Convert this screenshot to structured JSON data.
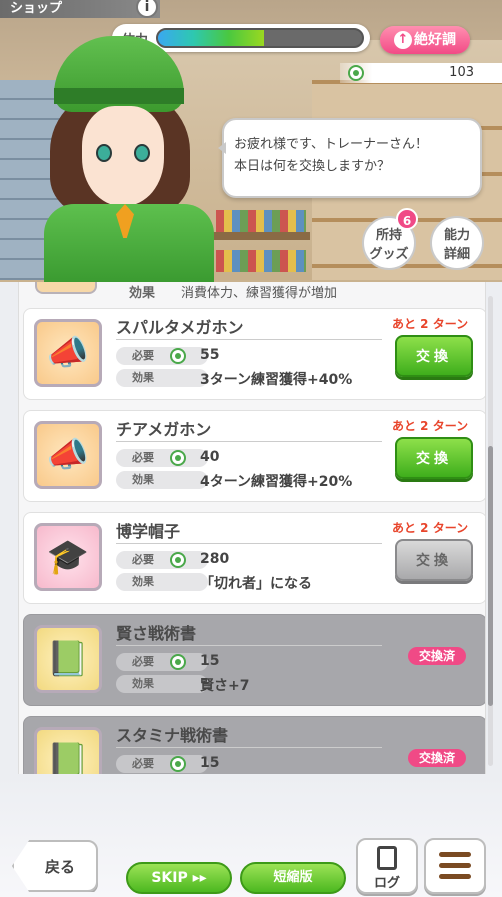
{
  "header": {
    "title": "ショップ",
    "info_icon": "i",
    "stamina_label": "体力",
    "stamina_fraction": 0.52,
    "mood_label": "絶好調",
    "mood_arrow": "↑",
    "coins": "103"
  },
  "dialog": {
    "line1": "お疲れ様です、トレーナーさん！",
    "line2": "本日は何を交換しますか？"
  },
  "side_buttons": {
    "owned_label_1": "所持",
    "owned_label_2": "グッズ",
    "owned_badge": "6",
    "ability_label_1": "能力",
    "ability_label_2": "詳細"
  },
  "labels": {
    "need": "必要",
    "effect": "効果",
    "exchange": "交換",
    "exchanged": "交換済"
  },
  "cut_item": {
    "effect_label": "効果",
    "effect": "消費体力、練習獲得が増加"
  },
  "items": [
    {
      "name": "スパルタメガホン",
      "cost": "55",
      "effect": "3ターン練習獲得+40%",
      "turns": "あと 2 ターン",
      "state": "available",
      "icon": "megaphone-icon",
      "bg": "orange"
    },
    {
      "name": "チアメガホン",
      "cost": "40",
      "effect": "4ターン練習獲得+20%",
      "turns": "あと 2 ターン",
      "state": "available",
      "icon": "megaphone-icon",
      "bg": "orange"
    },
    {
      "name": "博学帽子",
      "cost": "280",
      "effect": "「切れ者」になる",
      "turns": "あと 2 ターン",
      "state": "disabled",
      "icon": "graduation-cap-icon",
      "bg": "pink"
    },
    {
      "name": "賢さ戦術書",
      "cost": "15",
      "effect": "賢さ+7",
      "turns": "",
      "state": "exchanged",
      "icon": "book-icon",
      "bg": "yellow"
    },
    {
      "name": "スタミナ戦術書",
      "cost": "15",
      "effect": "",
      "turns": "",
      "state": "exchanged",
      "icon": "book-icon",
      "bg": "yellow"
    }
  ],
  "footer": {
    "back_label": "戻る",
    "skip_label": "SKIP ▸▸",
    "short_label": "短縮版",
    "log_label": "ログ"
  }
}
